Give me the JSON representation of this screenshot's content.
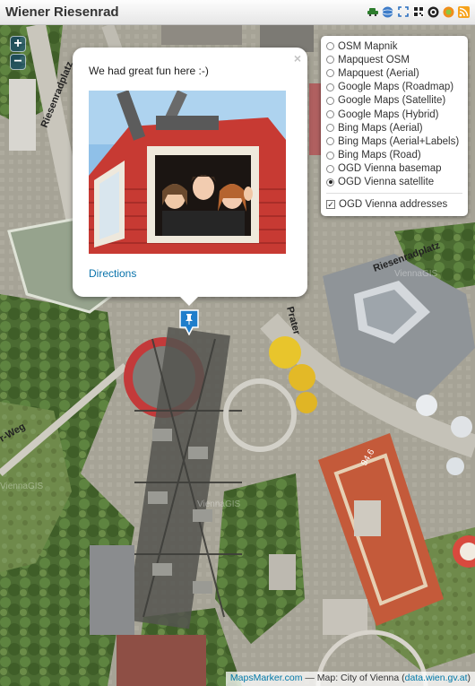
{
  "header": {
    "title": "Wiener Riesenrad",
    "icons": [
      "car-icon",
      "globe-icon",
      "fullscreen-icon",
      "qr-code-icon",
      "target-icon",
      "gps-icon",
      "rss-icon"
    ]
  },
  "map": {
    "street_labels": [
      "Riesenradplatz",
      "Riesenradplatz",
      "Prater",
      "r-Weg",
      "94.6"
    ],
    "watermarks": [
      "ViennaGIS",
      "ViennaGIS",
      "ViennaGIS"
    ]
  },
  "zoom": {
    "in": "+",
    "out": "−"
  },
  "layers": {
    "base": [
      {
        "label": "OSM Mapnik",
        "selected": false
      },
      {
        "label": "Mapquest OSM",
        "selected": false
      },
      {
        "label": "Mapquest (Aerial)",
        "selected": false
      },
      {
        "label": "Google Maps (Roadmap)",
        "selected": false
      },
      {
        "label": "Google Maps (Satellite)",
        "selected": false
      },
      {
        "label": "Google Maps (Hybrid)",
        "selected": false
      },
      {
        "label": "Bing Maps (Aerial)",
        "selected": false
      },
      {
        "label": "Bing Maps (Aerial+Labels)",
        "selected": false
      },
      {
        "label": "Bing Maps (Road)",
        "selected": false
      },
      {
        "label": "OGD Vienna basemap",
        "selected": false
      },
      {
        "label": "OGD Vienna satellite",
        "selected": true
      }
    ],
    "overlays": [
      {
        "label": "OGD Vienna addresses",
        "checked": true
      }
    ]
  },
  "popup": {
    "text": "We had great fun here :-)",
    "link": "Directions",
    "close": "×"
  },
  "attribution": {
    "link1": "MapsMarker.com",
    "middle": " — Map: City of Vienna (",
    "link2": "data.wien.gv.at",
    "end": ")"
  },
  "colors": {
    "link": "#0a73ab",
    "marker": "#1f7ecb"
  }
}
